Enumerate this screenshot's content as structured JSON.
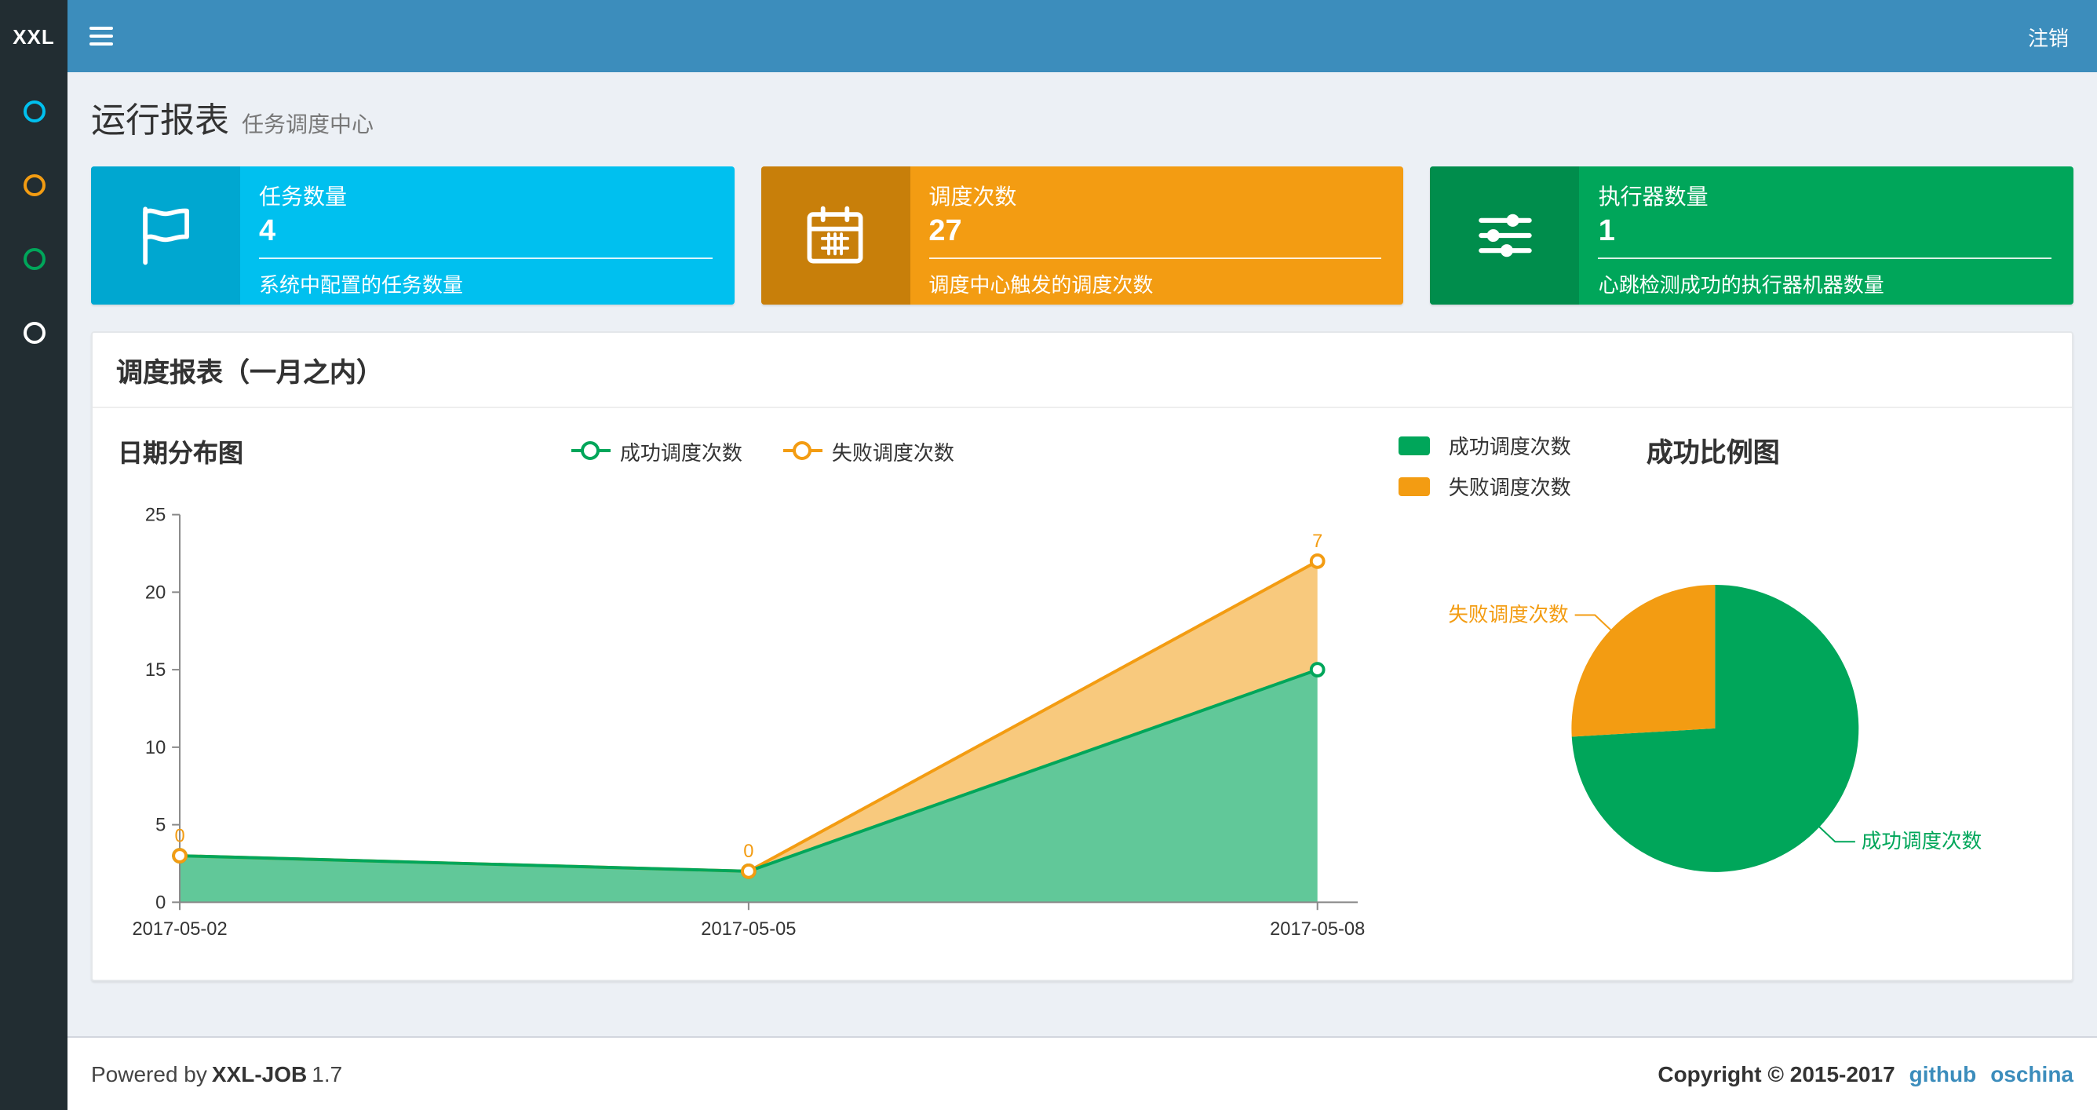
{
  "navbar": {
    "logo": "XXL",
    "logout": "注销"
  },
  "sidebar": {
    "icons": [
      {
        "name": "menu-dot-report",
        "color": "#00c0ef"
      },
      {
        "name": "menu-dot-jobs",
        "color": "#f39c12"
      },
      {
        "name": "menu-dot-executors",
        "color": "#00a65a"
      },
      {
        "name": "menu-dot-help",
        "color": "#ffffff"
      }
    ]
  },
  "page_header": {
    "title": "运行报表",
    "subtitle": "任务调度中心"
  },
  "info_boxes": [
    {
      "icon": "flag-icon",
      "title": "任务数量",
      "value": "4",
      "desc": "系统中配置的任务数量",
      "color": "#00c0ef",
      "icon_bg": "#00a7d0"
    },
    {
      "icon": "calendar-icon",
      "title": "调度次数",
      "value": "27",
      "desc": "调度中心触发的调度次数",
      "color": "#f39c12",
      "icon_bg": "#c87f0a"
    },
    {
      "icon": "sliders-icon",
      "title": "执行器数量",
      "value": "1",
      "desc": "心跳检测成功的执行器机器数量",
      "color": "#00a65a",
      "icon_bg": "#008d4c"
    }
  ],
  "panel": {
    "title": "调度报表（一月之内）"
  },
  "chart_data": [
    {
      "type": "area",
      "title": "日期分布图",
      "x": [
        "2017-05-02",
        "2017-05-05",
        "2017-05-08"
      ],
      "series": [
        {
          "name": "成功调度次数",
          "values": [
            3,
            2,
            15
          ],
          "color": "#00a65a"
        },
        {
          "name": "失败调度次数",
          "values": [
            0,
            0,
            7
          ],
          "color": "#f39c12"
        }
      ],
      "stacked": true,
      "ylim": [
        0,
        25
      ],
      "yticks": [
        0,
        5,
        10,
        15,
        20,
        25
      ],
      "point_labels": {
        "series": "失败调度次数",
        "values": [
          "0",
          "0",
          "7"
        ]
      },
      "legend_position": "top-center",
      "grid": false
    },
    {
      "type": "pie",
      "title": "成功比例图",
      "slices": [
        {
          "name": "成功调度次数",
          "value": 20,
          "color": "#00a65a"
        },
        {
          "name": "失败调度次数",
          "value": 7,
          "color": "#f39c12"
        }
      ],
      "legend_position": "top-left"
    }
  ],
  "footer": {
    "powered_prefix": "Powered by",
    "product": "XXL-JOB",
    "version": "1.7",
    "copyright": "Copyright © 2015-2017",
    "links": [
      {
        "label": "github"
      },
      {
        "label": "oschina"
      }
    ],
    "link_color": "#3c8dbc"
  }
}
